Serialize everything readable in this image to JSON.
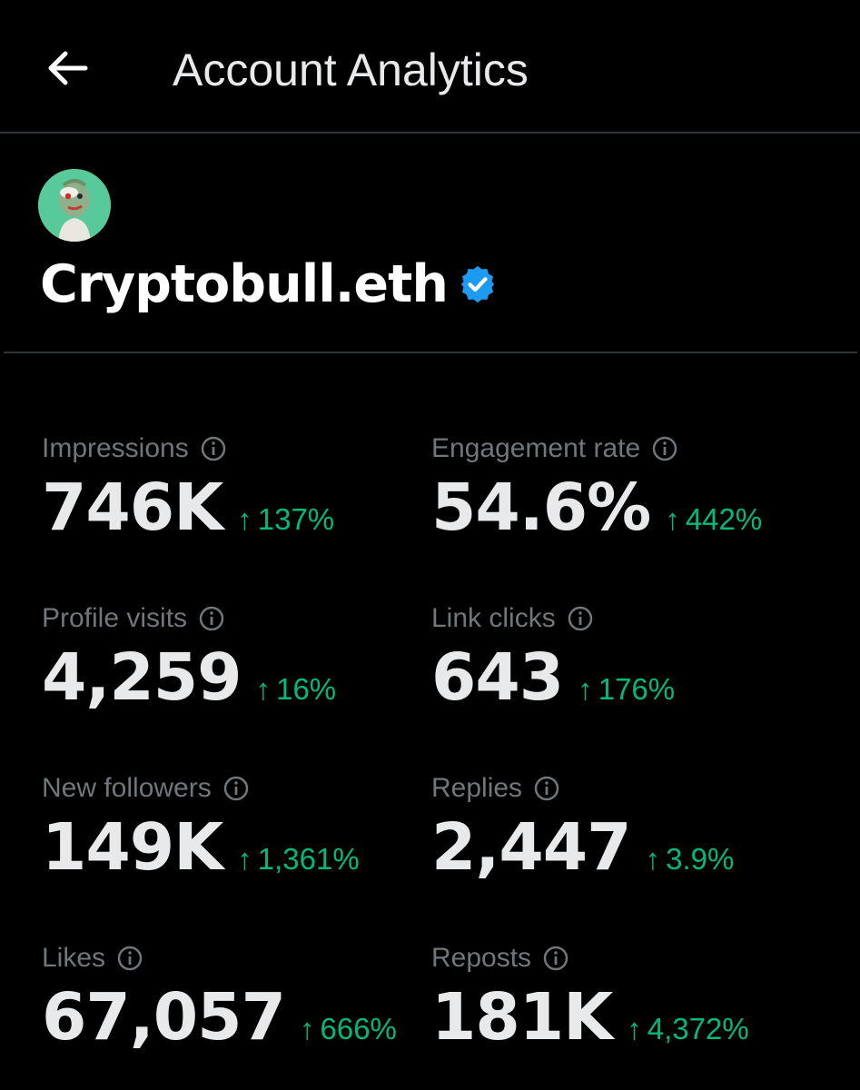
{
  "header": {
    "back_icon": "arrow-left-icon",
    "title": "Account Analytics"
  },
  "profile": {
    "name": "Cryptobull.eth",
    "verified_icon": "verified-badge-icon",
    "verified_color": "#1d9bf0"
  },
  "colors": {
    "positive": "#00ba7c",
    "label": "#71767b",
    "value": "#e7e9ea",
    "background": "#000000"
  },
  "metrics": [
    {
      "label": "Impressions",
      "value": "746K",
      "change": "137%",
      "direction": "up"
    },
    {
      "label": "Engagement rate",
      "value": "54.6%",
      "change": "442%",
      "direction": "up"
    },
    {
      "label": "Profile visits",
      "value": "4,259",
      "change": "16%",
      "direction": "up"
    },
    {
      "label": "Link clicks",
      "value": "643",
      "change": "176%",
      "direction": "up"
    },
    {
      "label": "New followers",
      "value": "149K",
      "change": "1,361%",
      "direction": "up"
    },
    {
      "label": "Replies",
      "value": "2,447",
      "change": "3.9%",
      "direction": "up"
    },
    {
      "label": "Likes",
      "value": "67,057",
      "change": "666%",
      "direction": "up"
    },
    {
      "label": "Reposts",
      "value": "181K",
      "change": "4,372%",
      "direction": "up"
    }
  ],
  "icons": {
    "info": "info-circle-icon",
    "change_arrow": "arrow-up-icon"
  }
}
